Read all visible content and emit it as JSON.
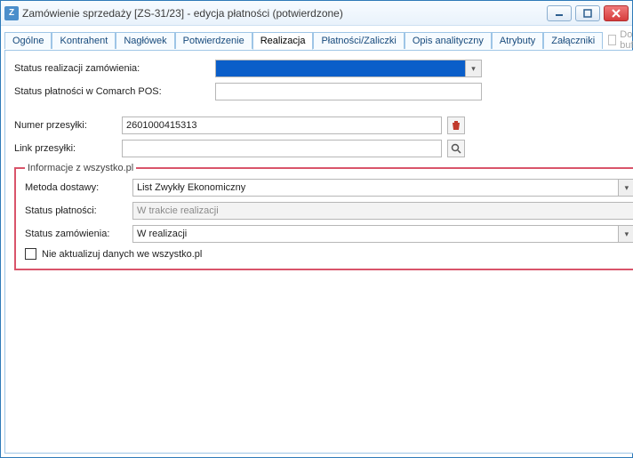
{
  "window": {
    "app_icon_letter": "Z",
    "title": "Zamówienie sprzedaży [ZS-31/23] - edycja płatności  (potwierdzone)"
  },
  "tabs": [
    "Ogólne",
    "Kontrahent",
    "Nagłówek",
    "Potwierdzenie",
    "Realizacja",
    "Płatności/Zaliczki",
    "Opis analityczny",
    "Atrybuty",
    "Załączniki"
  ],
  "active_tab_index": 4,
  "buffer_checkbox_label": "Do bufora",
  "fields": {
    "status_realizacji_label": "Status realizacji zamówienia:",
    "status_realizacji_value": "",
    "status_pos_label": "Status płatności w Comarch POS:",
    "status_pos_value": "",
    "numer_przesylki_label": "Numer przesyłki:",
    "numer_przesylki_value": "2601000415313",
    "link_przesylki_label": "Link przesyłki:",
    "link_przesylki_value": ""
  },
  "wszystko": {
    "legend": "Informacje z wszystko.pl",
    "metoda_label": "Metoda dostawy:",
    "metoda_value": "List Zwykły Ekonomiczny",
    "status_plat_label": "Status płatności:",
    "status_plat_value": "W trakcie realizacji",
    "status_zam_label": "Status zamówienia:",
    "status_zam_value": "W realizacji",
    "checkbox_label": "Nie aktualizuj danych we wszystko.pl"
  },
  "icons": {
    "trash": "trash-icon",
    "search": "search-icon",
    "save": "save-icon",
    "close": "close-icon",
    "export": "export-icon",
    "user": "user-icon",
    "unlock": "unlock-icon"
  }
}
